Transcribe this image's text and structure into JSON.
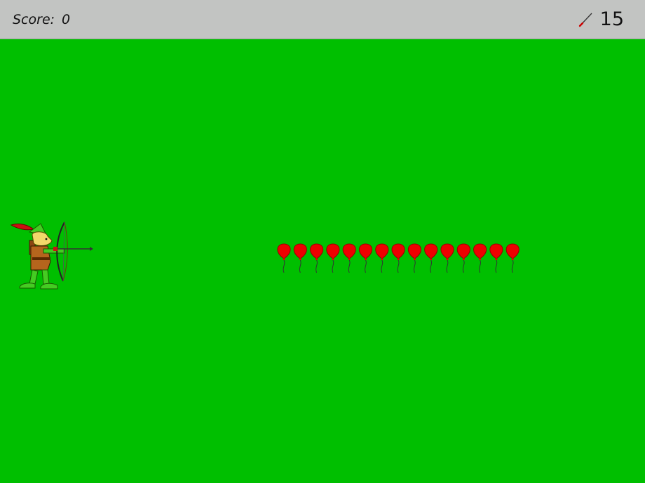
{
  "hud": {
    "score_label": "Score:",
    "score_value": "0",
    "arrows_icon": "arrow-icon",
    "arrows_remaining": "15"
  },
  "scene": {
    "balloon_count": 15,
    "balloon_color": "#ee0000",
    "balloon_outline": "#990000"
  },
  "colors": {
    "field": "#00bf00",
    "topbar": "#c2c4c2",
    "arrow_red": "#cc0000"
  }
}
